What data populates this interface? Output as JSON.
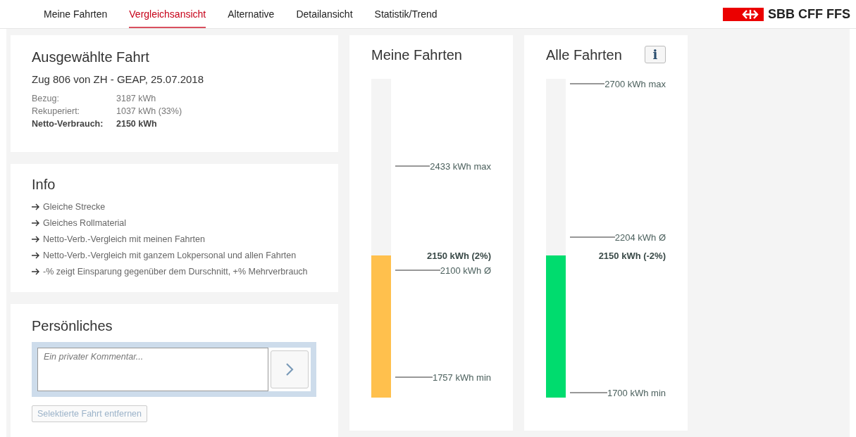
{
  "nav": {
    "tabs": [
      {
        "label": "Meine Fahrten",
        "selected": false
      },
      {
        "label": "Vergleichsansicht",
        "selected": true
      },
      {
        "label": "Alternative",
        "selected": false
      },
      {
        "label": "Detailansicht",
        "selected": false
      },
      {
        "label": "Statistik/Trend",
        "selected": false
      }
    ],
    "logo": "SBB CFF FFS"
  },
  "selected_trip": {
    "title": "Ausgewählte Fahrt",
    "subtitle": "Zug 806 von ZH - GEAP, 25.07.2018",
    "rows": [
      {
        "label": "Bezug:",
        "value": "3187 kWh",
        "bold": false
      },
      {
        "label": "Rekuperiert:",
        "value": "1037 kWh (33%)",
        "bold": false
      },
      {
        "label": "Netto-Verbrauch:",
        "value": "2150 kWh",
        "bold": true
      }
    ]
  },
  "info": {
    "title": "Info",
    "items": [
      "Gleiche Strecke",
      "Gleiches Rollmaterial",
      "Netto-Verb.-Vergleich mit meinen Fahrten",
      "Netto-Verb.-Vergleich mit ganzem Lokpersonal und allen Fahrten",
      "-% zeigt Einsparung gegenüber dem Durschnitt, +% Mehrverbrauch"
    ]
  },
  "personal": {
    "title": "Persönliches",
    "comment": {
      "placeholder": "Ein privater Kommentar..."
    },
    "remove_button": "Selektierte Fahrt entfernen"
  },
  "gauges": [
    {
      "title": "Meine Fahrten",
      "level": 0.446,
      "color": "#ffc04d",
      "current": "2150 kWh (2%)",
      "markers": [
        {
          "label": "2433 kWh max"
        },
        {
          "label": "2100 kWh Ø"
        },
        {
          "label": "1757 kWh min"
        }
      ]
    },
    {
      "title": "Alle Fahrten",
      "info_button": "i",
      "level": 0.446,
      "color": "#00dc6e",
      "current": "2150 kWh (-2%)",
      "markers": [
        {
          "label": "2700 kWh max"
        },
        {
          "label": "2204 kWh Ø"
        },
        {
          "label": "1700 kWh min"
        }
      ]
    }
  ]
}
